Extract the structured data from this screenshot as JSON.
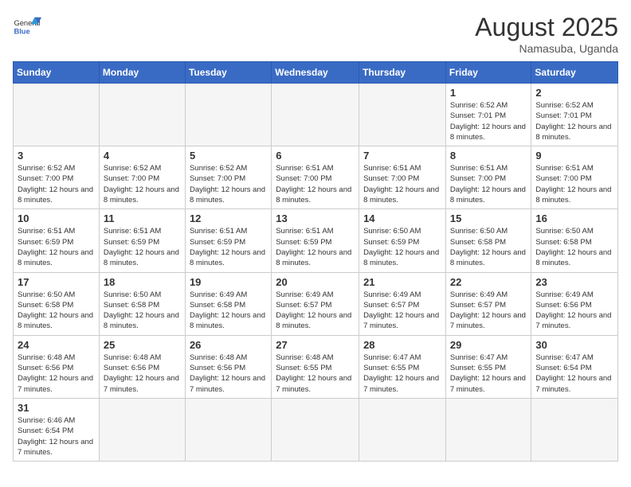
{
  "header": {
    "logo_text_normal": "General",
    "logo_text_bold": "Blue",
    "month_title": "August 2025",
    "location": "Namasuba, Uganda"
  },
  "days_of_week": [
    "Sunday",
    "Monday",
    "Tuesday",
    "Wednesday",
    "Thursday",
    "Friday",
    "Saturday"
  ],
  "weeks": [
    [
      {
        "day": "",
        "empty": true
      },
      {
        "day": "",
        "empty": true
      },
      {
        "day": "",
        "empty": true
      },
      {
        "day": "",
        "empty": true
      },
      {
        "day": "",
        "empty": true
      },
      {
        "day": "1",
        "sunrise": "6:52 AM",
        "sunset": "7:01 PM",
        "daylight": "12 hours and 8 minutes."
      },
      {
        "day": "2",
        "sunrise": "6:52 AM",
        "sunset": "7:01 PM",
        "daylight": "12 hours and 8 minutes."
      }
    ],
    [
      {
        "day": "3",
        "sunrise": "6:52 AM",
        "sunset": "7:00 PM",
        "daylight": "12 hours and 8 minutes."
      },
      {
        "day": "4",
        "sunrise": "6:52 AM",
        "sunset": "7:00 PM",
        "daylight": "12 hours and 8 minutes."
      },
      {
        "day": "5",
        "sunrise": "6:52 AM",
        "sunset": "7:00 PM",
        "daylight": "12 hours and 8 minutes."
      },
      {
        "day": "6",
        "sunrise": "6:51 AM",
        "sunset": "7:00 PM",
        "daylight": "12 hours and 8 minutes."
      },
      {
        "day": "7",
        "sunrise": "6:51 AM",
        "sunset": "7:00 PM",
        "daylight": "12 hours and 8 minutes."
      },
      {
        "day": "8",
        "sunrise": "6:51 AM",
        "sunset": "7:00 PM",
        "daylight": "12 hours and 8 minutes."
      },
      {
        "day": "9",
        "sunrise": "6:51 AM",
        "sunset": "7:00 PM",
        "daylight": "12 hours and 8 minutes."
      }
    ],
    [
      {
        "day": "10",
        "sunrise": "6:51 AM",
        "sunset": "6:59 PM",
        "daylight": "12 hours and 8 minutes."
      },
      {
        "day": "11",
        "sunrise": "6:51 AM",
        "sunset": "6:59 PM",
        "daylight": "12 hours and 8 minutes."
      },
      {
        "day": "12",
        "sunrise": "6:51 AM",
        "sunset": "6:59 PM",
        "daylight": "12 hours and 8 minutes."
      },
      {
        "day": "13",
        "sunrise": "6:51 AM",
        "sunset": "6:59 PM",
        "daylight": "12 hours and 8 minutes."
      },
      {
        "day": "14",
        "sunrise": "6:50 AM",
        "sunset": "6:59 PM",
        "daylight": "12 hours and 8 minutes."
      },
      {
        "day": "15",
        "sunrise": "6:50 AM",
        "sunset": "6:58 PM",
        "daylight": "12 hours and 8 minutes."
      },
      {
        "day": "16",
        "sunrise": "6:50 AM",
        "sunset": "6:58 PM",
        "daylight": "12 hours and 8 minutes."
      }
    ],
    [
      {
        "day": "17",
        "sunrise": "6:50 AM",
        "sunset": "6:58 PM",
        "daylight": "12 hours and 8 minutes."
      },
      {
        "day": "18",
        "sunrise": "6:50 AM",
        "sunset": "6:58 PM",
        "daylight": "12 hours and 8 minutes."
      },
      {
        "day": "19",
        "sunrise": "6:49 AM",
        "sunset": "6:58 PM",
        "daylight": "12 hours and 8 minutes."
      },
      {
        "day": "20",
        "sunrise": "6:49 AM",
        "sunset": "6:57 PM",
        "daylight": "12 hours and 8 minutes."
      },
      {
        "day": "21",
        "sunrise": "6:49 AM",
        "sunset": "6:57 PM",
        "daylight": "12 hours and 7 minutes."
      },
      {
        "day": "22",
        "sunrise": "6:49 AM",
        "sunset": "6:57 PM",
        "daylight": "12 hours and 7 minutes."
      },
      {
        "day": "23",
        "sunrise": "6:49 AM",
        "sunset": "6:56 PM",
        "daylight": "12 hours and 7 minutes."
      }
    ],
    [
      {
        "day": "24",
        "sunrise": "6:48 AM",
        "sunset": "6:56 PM",
        "daylight": "12 hours and 7 minutes."
      },
      {
        "day": "25",
        "sunrise": "6:48 AM",
        "sunset": "6:56 PM",
        "daylight": "12 hours and 7 minutes."
      },
      {
        "day": "26",
        "sunrise": "6:48 AM",
        "sunset": "6:56 PM",
        "daylight": "12 hours and 7 minutes."
      },
      {
        "day": "27",
        "sunrise": "6:48 AM",
        "sunset": "6:55 PM",
        "daylight": "12 hours and 7 minutes."
      },
      {
        "day": "28",
        "sunrise": "6:47 AM",
        "sunset": "6:55 PM",
        "daylight": "12 hours and 7 minutes."
      },
      {
        "day": "29",
        "sunrise": "6:47 AM",
        "sunset": "6:55 PM",
        "daylight": "12 hours and 7 minutes."
      },
      {
        "day": "30",
        "sunrise": "6:47 AM",
        "sunset": "6:54 PM",
        "daylight": "12 hours and 7 minutes."
      }
    ],
    [
      {
        "day": "31",
        "sunrise": "6:46 AM",
        "sunset": "6:54 PM",
        "daylight": "12 hours and 7 minutes."
      },
      {
        "day": "",
        "empty": true
      },
      {
        "day": "",
        "empty": true
      },
      {
        "day": "",
        "empty": true
      },
      {
        "day": "",
        "empty": true
      },
      {
        "day": "",
        "empty": true
      },
      {
        "day": "",
        "empty": true
      }
    ]
  ]
}
